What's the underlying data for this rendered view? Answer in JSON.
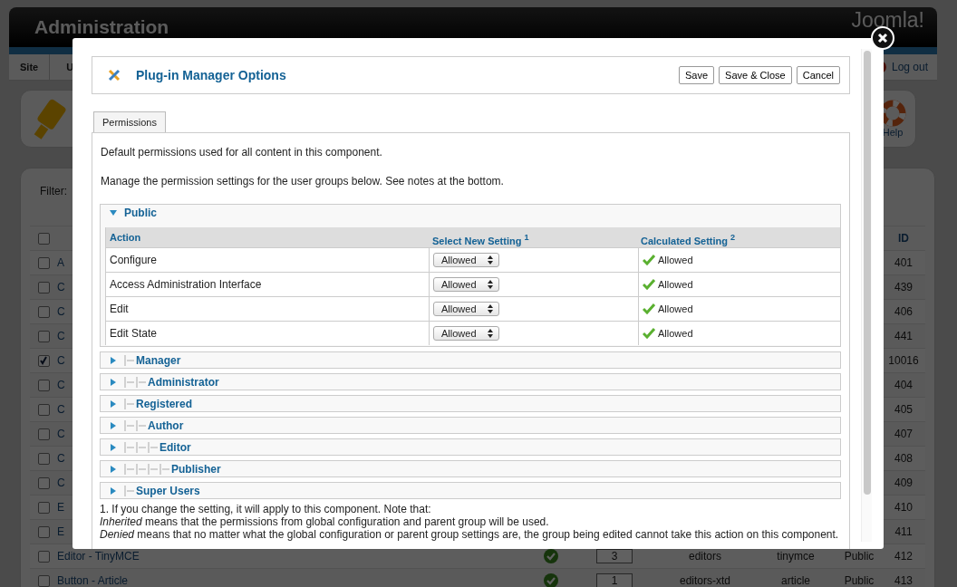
{
  "header": {
    "title": "Administration",
    "logo": "Joomla!"
  },
  "menu": {
    "items": [
      "Site",
      "U"
    ],
    "logout": "Log out"
  },
  "toolbar": {
    "help": "Help"
  },
  "filter": {
    "label": "Filter:"
  },
  "plugins_table": {
    "id_heading": "ID",
    "select_all_checked": false,
    "rows": [
      {
        "name": "A",
        "checked": false,
        "id": "401"
      },
      {
        "name": "C",
        "checked": false,
        "id": "439"
      },
      {
        "name": "C",
        "checked": false,
        "id": "406"
      },
      {
        "name": "C",
        "checked": false,
        "id": "441"
      },
      {
        "name": "C",
        "checked": true,
        "id": "10016"
      },
      {
        "name": "C",
        "checked": false,
        "id": "404"
      },
      {
        "name": "C",
        "checked": false,
        "id": "405"
      },
      {
        "name": "C",
        "checked": false,
        "id": "407"
      },
      {
        "name": "C",
        "checked": false,
        "id": "408"
      },
      {
        "name": "C",
        "checked": false,
        "id": "409"
      },
      {
        "name": "E",
        "checked": false,
        "id": "410"
      },
      {
        "name": "E",
        "checked": false,
        "id": "411"
      },
      {
        "name": "Editor - TinyMCE",
        "checked": false,
        "enabled": true,
        "order": "3",
        "type": "editors",
        "element": "tinymce",
        "access": "Public",
        "id": "412"
      },
      {
        "name": "Button - Article",
        "checked": false,
        "enabled": true,
        "order": "1",
        "type": "editors-xtd",
        "element": "article",
        "access": "Public",
        "id": "413"
      }
    ]
  },
  "dialog": {
    "title": "Plug-in Manager Options",
    "buttons": [
      "Save",
      "Save & Close",
      "Cancel"
    ],
    "tabs": [
      {
        "label": "Permissions",
        "selected": true
      }
    ],
    "intro": "Default permissions used for all content in this component.",
    "instructions": "Manage the permission settings for the user groups below. See notes at the bottom.",
    "columns": [
      "Action",
      "Select New Setting $^{1}$",
      "Calculated Setting $^{2}$"
    ],
    "groups": [
      {
        "name": "Public",
        "expanded": true,
        "permissions": [
          {
            "action": "Configure",
            "setting": "Allowed",
            "calculated": "Allowed"
          },
          {
            "action": "Access Administration Interface",
            "setting": "Allowed",
            "calculated": "Allowed"
          },
          {
            "action": "Edit",
            "setting": "Allowed",
            "calculated": "Allowed"
          },
          {
            "action": "Edit State",
            "setting": "Allowed",
            "calculated": "Allowed"
          }
        ],
        "children": [
          {
            "name": "Manager",
            "expanded": false,
            "children": [
              {
                "name": "Administrator",
                "expanded": false
              }
            ]
          },
          {
            "name": "Registered",
            "expanded": false,
            "children": [
              {
                "name": "Author",
                "expanded": false,
                "children": [
                  {
                    "name": "Editor",
                    "expanded": false,
                    "children": [
                      {
                        "name": "Publisher",
                        "expanded": false
                      }
                    ]
                  }
                ]
              }
            ]
          },
          {
            "name": "Super Users",
            "expanded": false
          }
        ]
      }
    ],
    "notes": [
      "1. If you change the setting, it will apply to this component. Note that:",
      "*Inherited* means that the permissions from global configuration and parent group will be used.",
      "*Denied* means that no matter what the global configuration or parent group settings are, the group being edited cannot take this action on this component."
    ]
  }
}
